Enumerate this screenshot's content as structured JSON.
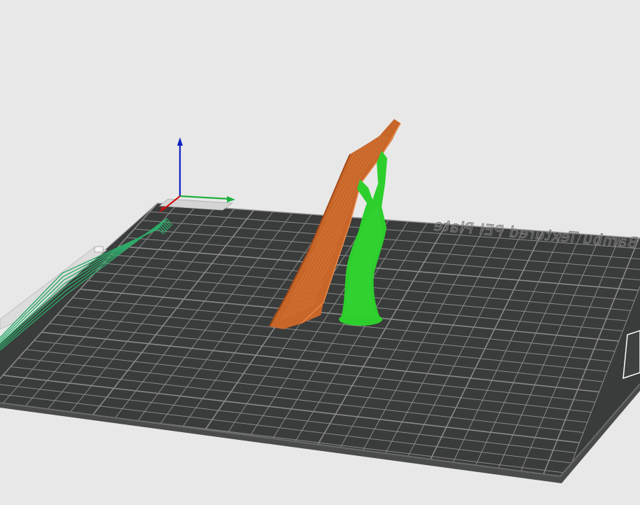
{
  "viewport": {
    "title": "",
    "background": "#e8e8e8"
  },
  "build_plate": {
    "label": "Textured PEI Plate",
    "label_partial": "Bambu Textured PEI Plate",
    "surface_color": "#3a3b3b",
    "grid_color": "#8a8a8a",
    "rim_color": "#4a4b4b"
  },
  "axes": {
    "x_color": "#d01010",
    "y_color": "#20b040",
    "z_color": "#1020c0"
  },
  "objects": [
    {
      "name": "orange-model",
      "color": "#c8662a"
    },
    {
      "name": "green-model",
      "color": "#2dcf2d"
    }
  ],
  "cross_section_color": "#2faa6a"
}
